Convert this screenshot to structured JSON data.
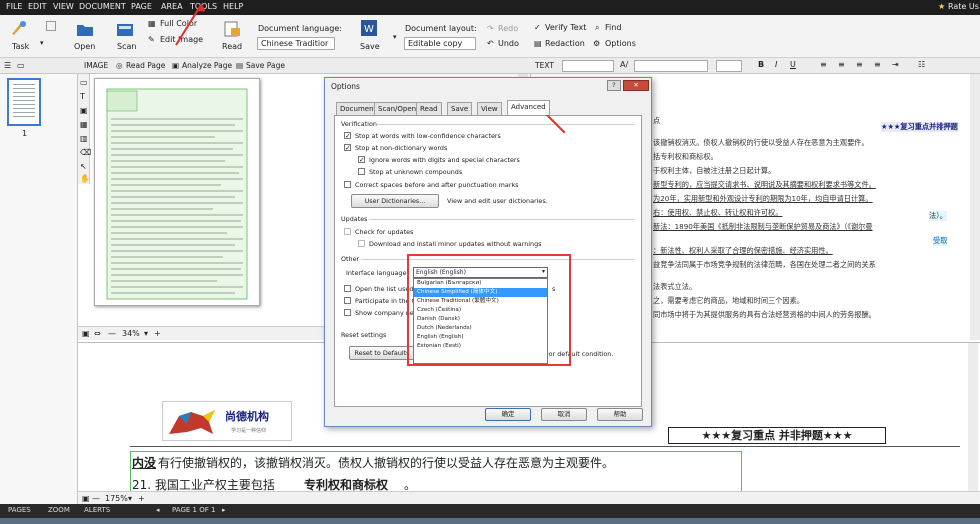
{
  "menu": {
    "items": [
      "FILE",
      "EDIT",
      "VIEW",
      "DOCUMENT",
      "PAGE",
      "AREA",
      "TOOLS",
      "HELP"
    ],
    "rate": "Rate Us"
  },
  "toolbar": {
    "task": "Task",
    "open": "Open",
    "scan": "Scan",
    "full_color": "Full Color",
    "edit_image": "Edit Image",
    "read": "Read",
    "doc_lang_label": "Document language:",
    "doc_lang_value": "Chinese Traditior",
    "save": "Save",
    "doc_layout_label": "Document layout:",
    "doc_layout_value": "Editable copy",
    "redo": "Redo",
    "undo": "Undo",
    "verify_text": "Verify Text",
    "find": "Find",
    "redaction": "Redaction",
    "options": "Options"
  },
  "panebar": {
    "image_label": "IMAGE",
    "read_page": "Read Page",
    "analyze_page": "Analyze Page",
    "save_page": "Save Page",
    "text_label": "TEXT"
  },
  "thumbs": {
    "page_number": "1"
  },
  "image_zoom": "34%",
  "zoom_value": "175%",
  "statusbar": {
    "pages": "PAGES",
    "zoom": "ZOOM",
    "alerts": "ALERTS",
    "page_of": "PAGE 1 OF 1"
  },
  "dialog": {
    "title": "Options",
    "tabs": [
      "Document",
      "Scan/Open",
      "Read",
      "Save",
      "View",
      "Advanced"
    ],
    "verification_header": "Verification",
    "stop_low_conf": "Stop at words with low-confidence characters",
    "stop_non_dict": "Stop at non-dictionary words",
    "ignore_digits": "Ignore words with digits and special characters",
    "stop_compounds": "Stop at unknown compounds",
    "correct_spaces": "Correct spaces before and after punctuation marks",
    "user_dict_button": "User Dictionaries...",
    "user_dict_text": "View and edit user dictionaries.",
    "updates_header": "Updates",
    "check_updates": "Check for updates",
    "download_updates": "Download and install minor updates without warnings",
    "other_header": "Other",
    "interface_lang_label": "Interface language:",
    "interface_lang_value": "English (English)",
    "open_list": "Open the list used",
    "participate": "Participate in the C",
    "show_company": "Show company new",
    "reset_header": "Reset settings",
    "reset_button": "Reset to Defaults",
    "reset_text": "olor default condition.",
    "ok": "确定",
    "cancel": "取消",
    "help": "帮助",
    "options_trunc": "s",
    "lang_options": [
      "Bulgarian (Български)",
      "Chinese Simplified (简体中文)",
      "Chinese Traditional (繁體中文)",
      "Czech (Čeština)",
      "Danish (Dansk)",
      "Dutch (Nederlands)",
      "English (English)",
      "Estonian (Eesti)"
    ]
  },
  "text_pane": {
    "first": "点",
    "stars": "★★★复习重点并排押题",
    "lines": [
      "该撤销权消灭。债权人撤销权的行使以受益人存在恶意为主观要件。",
      "括专利权和商标权。",
      "于权利主体，自被注注册之日起计算。",
      "新型专利的，应当提交请求书、说明说及其摘要和权利要求书等文件。",
      "为20年，实用新型和外观设计专利的期限为10年，均自申请日计算。",
      "右：使用权、禁止权、转让权和许可权。",
      "新法：1890年美国《抵制非法限制与垄断保护贸易及商法》（《谢尔曼",
      "：新法性、权利人采取了合理的保密措施、经济实用性。",
      "益竞争法同属于市场竞争规制的法律范畴，各国在处理二者之间的关系",
      "法表式立法。",
      "之，需要考虑它的商品，地域和时间三个因素。",
      "同市场中将于为其提供服务的具有合法经营资格的中间人的劳务报酬。"
    ],
    "tail1": "法）。",
    "tail2": "受取"
  },
  "zoom_content": {
    "logo_text": "尚德机构",
    "logo_sub": "学习是一种信仰",
    "stars": "★★★复习重点 并非押题★★★",
    "line1_bold": "内没",
    "line1": "有行使撤销权的，该撤销权消灭。债权人撤销权的行使以受益人存在恶意为主观要件。",
    "line2_pre": "21. 我国工业产权主要包括",
    "line2_bold": "专利权和商标权",
    "line2_end": "。"
  },
  "colors": {
    "arrow": "#e52b2b",
    "highlight_box": "#e53935",
    "green_box": "#5cb85c"
  }
}
